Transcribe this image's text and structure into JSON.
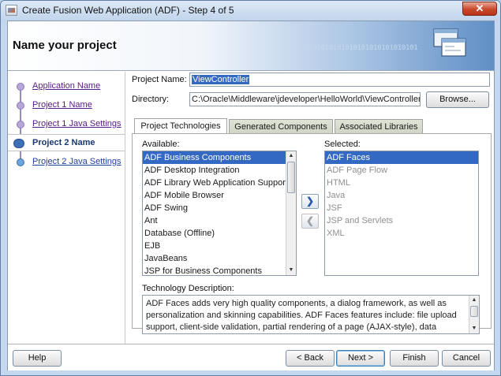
{
  "window": {
    "title": "Create Fusion Web Application (ADF) - Step 4 of 5",
    "close_glyph": "✕"
  },
  "header": {
    "title": "Name your project",
    "banner_binary": "0101010101010101010101010101"
  },
  "nav": {
    "items": [
      {
        "label": "Application Name",
        "state": "visited"
      },
      {
        "label": "Project 1 Name",
        "state": "visited"
      },
      {
        "label": "Project 1 Java Settings",
        "state": "visited"
      },
      {
        "label": "Project 2 Name",
        "state": "current"
      },
      {
        "label": "Project 2 Java Settings",
        "state": "upcoming"
      }
    ]
  },
  "form": {
    "project_name_label": "Project Name:",
    "project_name_value": "ViewController",
    "directory_label": "Directory:",
    "directory_value": "C:\\Oracle\\Middleware\\jdeveloper\\HelloWorld\\ViewController",
    "browse_label": "Browse..."
  },
  "tabs": [
    {
      "label": "Project Technologies",
      "active": true
    },
    {
      "label": "Generated Components",
      "active": false
    },
    {
      "label": "Associated Libraries",
      "active": false
    }
  ],
  "technologies": {
    "available_label": "Available:",
    "selected_label": "Selected:",
    "available": [
      "ADF Business Components",
      "ADF Desktop Integration",
      "ADF Library Web Application Support",
      "ADF Mobile Browser",
      "ADF Swing",
      "Ant",
      "Database (Offline)",
      "EJB",
      "JavaBeans",
      "JSP for Business Components"
    ],
    "available_selected_index": 0,
    "selected": [
      "ADF Faces",
      "ADF Page Flow",
      "HTML",
      "Java",
      "JSF",
      "JSP and Servlets",
      "XML"
    ],
    "selected_selected_index": 0,
    "add_glyph": "❯",
    "remove_glyph": "❮",
    "description_label": "Technology Description:",
    "description_text": "ADF Faces adds very high quality components, a dialog framework, as well as personalization and skinning capabilities. ADF Faces features include: file upload support, client-side validation, partial rendering of a page (AJAX-style), data tables,"
  },
  "footer": {
    "help": "Help",
    "back": "< Back",
    "next": "Next >",
    "finish": "Finish",
    "cancel": "Cancel"
  },
  "colors": {
    "selection": "#3369c3",
    "visited_link": "#551a8b",
    "upcoming_link": "#1f3ea5",
    "window_frame": "#c3d8ee"
  }
}
